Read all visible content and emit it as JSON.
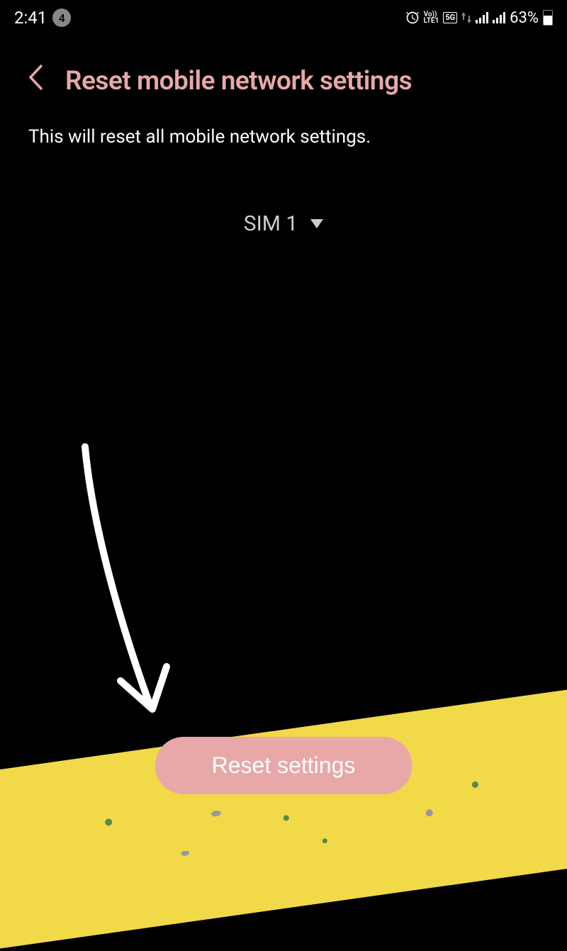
{
  "statusBar": {
    "time": "2:41",
    "notificationCount": "4",
    "lteLine1": "Vo))",
    "lteLine2": "LTE1",
    "networkBadge": "5G",
    "batteryPercent": "63%"
  },
  "header": {
    "title": "Reset mobile network settings"
  },
  "body": {
    "description": "This will reset all mobile network settings.",
    "simLabel": "SIM 1"
  },
  "actions": {
    "resetButton": "Reset settings"
  }
}
